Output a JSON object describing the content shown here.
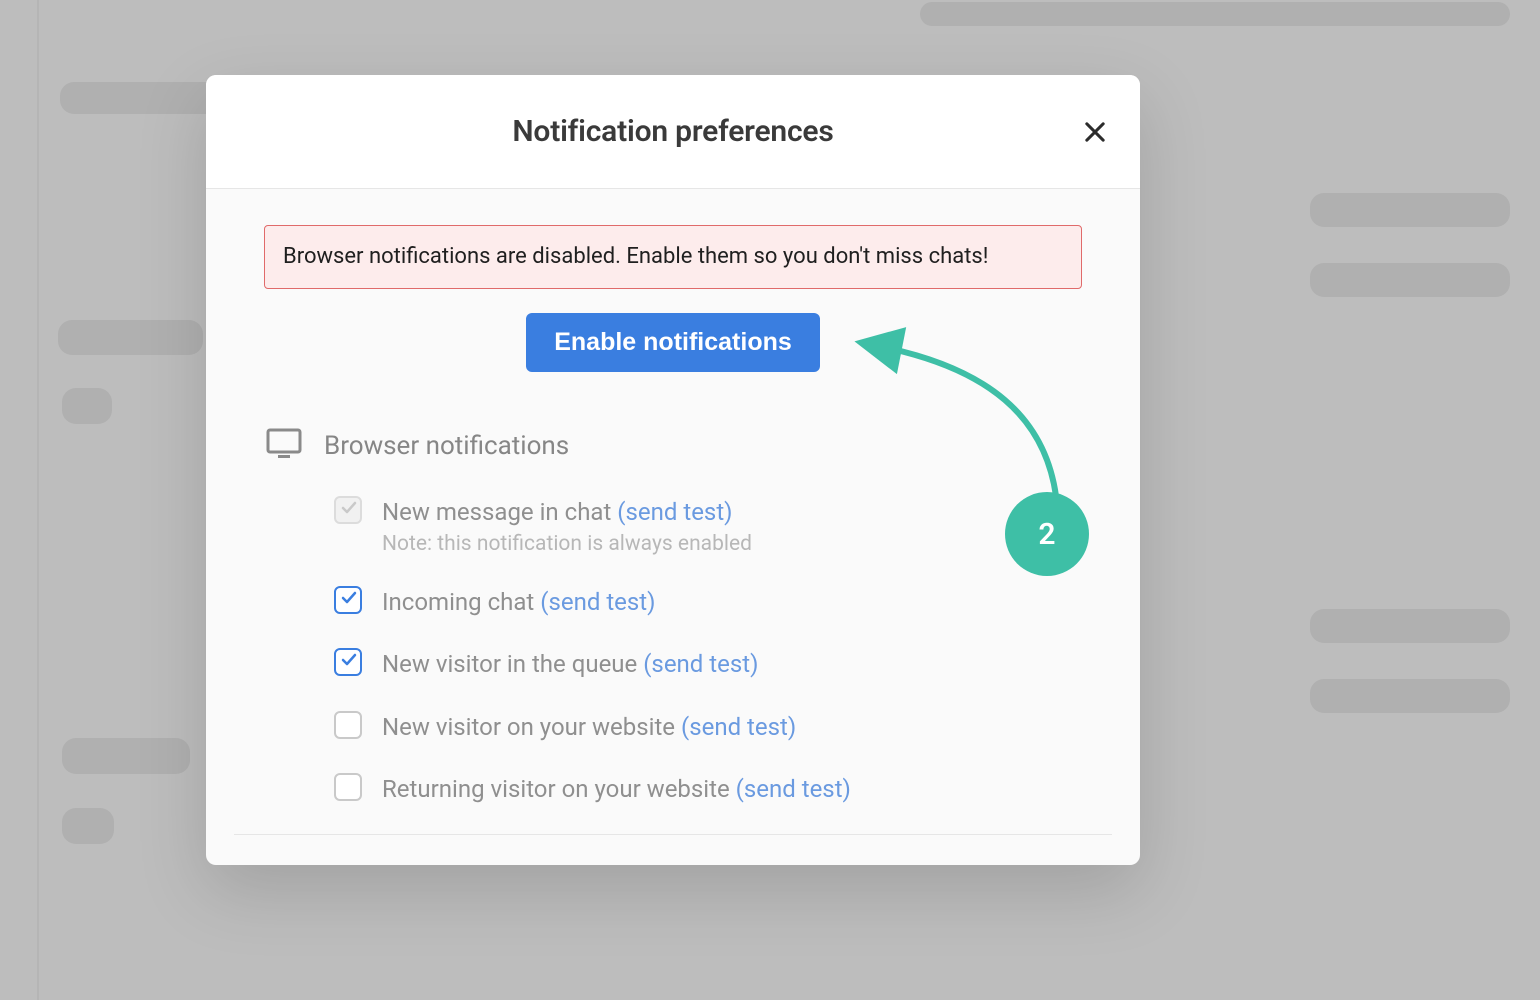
{
  "modal": {
    "title": "Notification preferences",
    "alert_text": "Browser notifications are disabled. Enable them so you don't miss chats!",
    "enable_button_label": "Enable notifications"
  },
  "section": {
    "title": "Browser notifications",
    "send_test_label": "(send test)",
    "options": [
      {
        "label": "New message in chat",
        "checked": true,
        "disabled": true,
        "note": "Note: this notification is always enabled"
      },
      {
        "label": "Incoming chat",
        "checked": true,
        "disabled": false,
        "note": ""
      },
      {
        "label": "New visitor in the queue",
        "checked": true,
        "disabled": false,
        "note": ""
      },
      {
        "label": "New visitor on your website",
        "checked": false,
        "disabled": false,
        "note": ""
      },
      {
        "label": "Returning visitor on your website",
        "checked": false,
        "disabled": false,
        "note": ""
      }
    ]
  },
  "annotation": {
    "step_number": "2"
  }
}
